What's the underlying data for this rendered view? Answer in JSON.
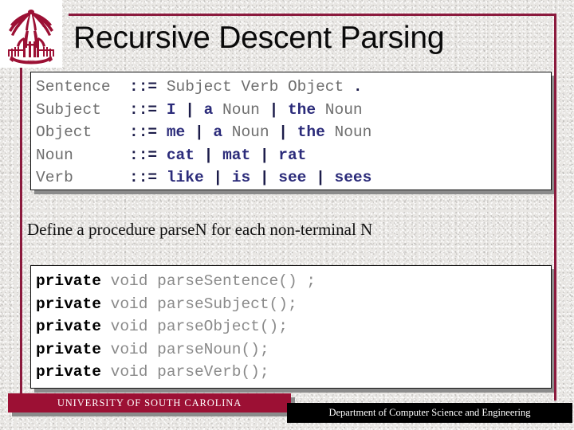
{
  "slide": {
    "title": "Recursive Descent Parsing",
    "body_text": "Define a procedure parseN for each non-terminal N"
  },
  "theme": {
    "maroon": "#8b1a3d",
    "footer_maroon": "#9c1034",
    "terminal_blue": "#2b2b7a",
    "nonterminal_gray": "#6e6e6e",
    "code_gray": "#8a8a8a",
    "background": "#e9e7e4"
  },
  "grammar": {
    "rows": [
      {
        "lhs": "Sentence",
        "lhs_pad": "Sentence  ",
        "op": "::=",
        "rhs": [
          {
            "text": " Subject Verb Object ",
            "kind": "nonterminal"
          },
          {
            "text": ".",
            "kind": "punct"
          }
        ]
      },
      {
        "lhs": "Subject",
        "lhs_pad": "Subject   ",
        "op": "::=",
        "rhs": [
          {
            "text": " ",
            "kind": "nonterminal"
          },
          {
            "text": "I",
            "kind": "terminal"
          },
          {
            "text": " ",
            "kind": "nonterminal"
          },
          {
            "text": "|",
            "kind": "punct"
          },
          {
            "text": " ",
            "kind": "nonterminal"
          },
          {
            "text": "a",
            "kind": "terminal"
          },
          {
            "text": " Noun ",
            "kind": "nonterminal"
          },
          {
            "text": "|",
            "kind": "punct"
          },
          {
            "text": " ",
            "kind": "nonterminal"
          },
          {
            "text": "the",
            "kind": "terminal"
          },
          {
            "text": " Noun",
            "kind": "nonterminal"
          }
        ]
      },
      {
        "lhs": "Object",
        "lhs_pad": "Object    ",
        "op": "::=",
        "rhs": [
          {
            "text": " ",
            "kind": "nonterminal"
          },
          {
            "text": "me",
            "kind": "terminal"
          },
          {
            "text": " ",
            "kind": "nonterminal"
          },
          {
            "text": "|",
            "kind": "punct"
          },
          {
            "text": " ",
            "kind": "nonterminal"
          },
          {
            "text": "a",
            "kind": "terminal"
          },
          {
            "text": " Noun ",
            "kind": "nonterminal"
          },
          {
            "text": "|",
            "kind": "punct"
          },
          {
            "text": " ",
            "kind": "nonterminal"
          },
          {
            "text": "the",
            "kind": "terminal"
          },
          {
            "text": " Noun",
            "kind": "nonterminal"
          }
        ]
      },
      {
        "lhs": "Noun",
        "lhs_pad": "Noun      ",
        "op": "::=",
        "rhs": [
          {
            "text": " ",
            "kind": "nonterminal"
          },
          {
            "text": "cat",
            "kind": "terminal"
          },
          {
            "text": " ",
            "kind": "nonterminal"
          },
          {
            "text": "|",
            "kind": "punct"
          },
          {
            "text": " ",
            "kind": "nonterminal"
          },
          {
            "text": "mat",
            "kind": "terminal"
          },
          {
            "text": " ",
            "kind": "nonterminal"
          },
          {
            "text": "|",
            "kind": "punct"
          },
          {
            "text": " ",
            "kind": "nonterminal"
          },
          {
            "text": "rat",
            "kind": "terminal"
          }
        ]
      },
      {
        "lhs": "Verb",
        "lhs_pad": "Verb      ",
        "op": "::=",
        "rhs": [
          {
            "text": " ",
            "kind": "nonterminal"
          },
          {
            "text": "like",
            "kind": "terminal"
          },
          {
            "text": " ",
            "kind": "nonterminal"
          },
          {
            "text": "|",
            "kind": "punct"
          },
          {
            "text": " ",
            "kind": "nonterminal"
          },
          {
            "text": "is",
            "kind": "terminal"
          },
          {
            "text": " ",
            "kind": "nonterminal"
          },
          {
            "text": "|",
            "kind": "punct"
          },
          {
            "text": " ",
            "kind": "nonterminal"
          },
          {
            "text": "see",
            "kind": "terminal"
          },
          {
            "text": " ",
            "kind": "nonterminal"
          },
          {
            "text": "|",
            "kind": "punct"
          },
          {
            "text": " ",
            "kind": "nonterminal"
          },
          {
            "text": "sees",
            "kind": "terminal"
          }
        ]
      }
    ]
  },
  "code": {
    "lines": [
      {
        "keyword": "private",
        "rest": " void parseSentence() ;"
      },
      {
        "keyword": "private",
        "rest": " void parseSubject();"
      },
      {
        "keyword": "private",
        "rest": " void parseObject();"
      },
      {
        "keyword": "private",
        "rest": " void parseNoun();"
      },
      {
        "keyword": "private",
        "rest": " void parseVerb();"
      }
    ]
  },
  "footer": {
    "university": "UNIVERSITY OF SOUTH CAROLINA",
    "department": "Department of Computer Science and Engineering"
  },
  "logo": {
    "name": "usc-palmetto-logo"
  }
}
